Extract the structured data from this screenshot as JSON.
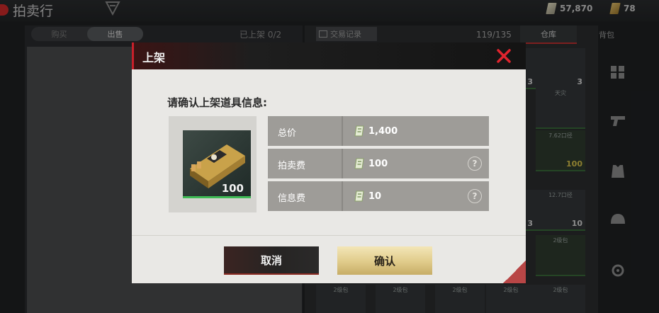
{
  "topbar": {
    "title": "拍卖行",
    "currency_cash": "57,870",
    "currency_gold": "78"
  },
  "left": {
    "tab_buy": "购买",
    "tab_sell": "出售",
    "listed_label": "已上架",
    "listed_count": "0/2"
  },
  "right": {
    "trade_record": "交易记录",
    "capacity": "119/135",
    "tab_warehouse": "仓库",
    "tab_backpack": "背包",
    "cells": [
      {
        "label": "",
        "qty": "3"
      },
      {
        "label": "",
        "qty": "3"
      },
      {
        "label": "天灾",
        "qty": ""
      },
      {
        "label": "7.62口径",
        "qty": "100"
      },
      {
        "label": "12.7口径",
        "qty": "10"
      },
      {
        "label": "7.62口径",
        "qty": "3"
      },
      {
        "label": "2级包",
        "qty": ""
      },
      {
        "label": "2级包",
        "qty": ""
      },
      {
        "label": "2级包",
        "qty": ""
      },
      {
        "label": "2级包",
        "qty": ""
      },
      {
        "label": "2级包",
        "qty": ""
      },
      {
        "label": "2级包",
        "qty": ""
      }
    ]
  },
  "modal": {
    "title": "上架",
    "prompt": "请确认上架道具信息:",
    "item_qty": "100",
    "rows": [
      {
        "label": "总价",
        "value": "1,400",
        "help": false
      },
      {
        "label": "拍卖费",
        "value": "100",
        "help": true
      },
      {
        "label": "信息费",
        "value": "10",
        "help": true
      }
    ],
    "cancel": "取消",
    "confirm": "确认"
  },
  "colors": {
    "accent_red": "#c8202a",
    "confirm_gold": "#e0cb8a",
    "progress_green": "#3fbb55"
  },
  "icons": [
    "filter-icon",
    "cash-icon",
    "gold-icon",
    "close-icon",
    "help-icon",
    "ammo-box-icon",
    "grid-icon",
    "pistol-icon",
    "vest-icon",
    "helmet-icon",
    "settings-icon"
  ]
}
